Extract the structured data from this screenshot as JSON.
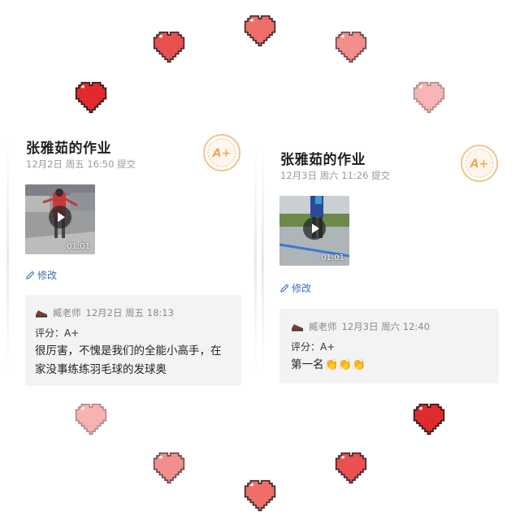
{
  "colors": {
    "heart_red": "#e8383d",
    "heart_pink": "#f0908f",
    "heart_light": "#f6b6b6",
    "link_blue": "#3a6fb4",
    "badge_orange": "#f4c38f"
  },
  "submissions": [
    {
      "title": "张雅茹的作业",
      "submitted_at": "12月2日 周五 16:50 提交",
      "grade_badge": "A+",
      "video_duration": "01:01",
      "edit_label": "修改",
      "comment": {
        "teacher": "臧老师",
        "time": "12月2日 周五 18:13",
        "score": "评分：A+",
        "line1": "很厉害，不愧是我们的全能小高手，在",
        "line2": "家没事练练羽毛球的发球奥"
      }
    },
    {
      "title": "张雅茹的作业",
      "submitted_at": "12月3日 周六 11:26 提交",
      "grade_badge": "A+",
      "video_duration": "01:01",
      "edit_label": "修改",
      "comment": {
        "teacher": "臧老师",
        "time": "12月3日 周六 12:40",
        "score": "评分：A+",
        "text": "第一名",
        "emoji": "👏👏👏"
      }
    }
  ]
}
